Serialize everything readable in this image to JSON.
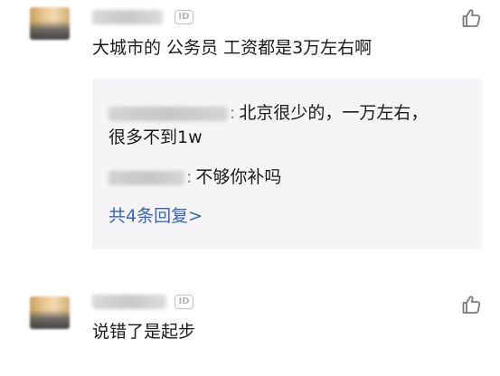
{
  "comments": [
    {
      "badge": "ID",
      "text": "大城市的 公务员 工资都是3万左右啊",
      "replies": [
        {
          "separator": ":",
          "text_line1": "北京很少的，一万左右，",
          "text_line2": "很多不到1w"
        },
        {
          "separator": ":",
          "text": "不够你补吗"
        }
      ],
      "more_replies": "共4条回复>"
    },
    {
      "badge": "ID",
      "text": "说错了是起步"
    }
  ],
  "colors": {
    "link": "#3563c4",
    "reply_bg": "#f5f5f7",
    "icon_gray": "#7a7a7a"
  },
  "icons": {
    "like": "thumbs-up-icon"
  }
}
